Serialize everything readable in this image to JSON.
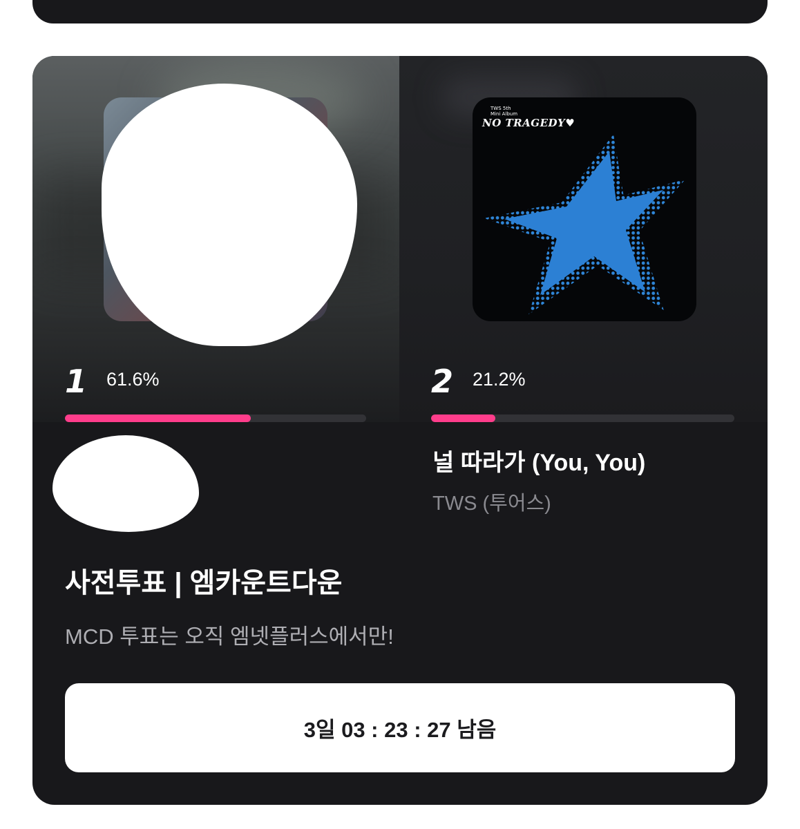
{
  "poll": {
    "entries": [
      {
        "rank": "1",
        "percent": "61.6%",
        "percent_value": 61.6,
        "title": "",
        "artist": ""
      },
      {
        "rank": "2",
        "percent": "21.2%",
        "percent_value": 21.2,
        "title": "널 따라가 (You, You)",
        "artist": "TWS (투어스)",
        "album_cover": {
          "title": "NO TRAGEDY♥",
          "subtitle_line1": "TWS 5th",
          "subtitle_line2": "Mini Album"
        }
      }
    ],
    "title": "사전투표 | 엠카운트다운",
    "description": "MCD 투표는 오직 엠넷플러스에서만!",
    "countdown": "3일 03 : 23 : 27 남음"
  },
  "colors": {
    "card_bg": "#18181b",
    "progress_fill": "#ff3d8b",
    "progress_track": "#323236",
    "star_blue": "#2f86d8"
  }
}
